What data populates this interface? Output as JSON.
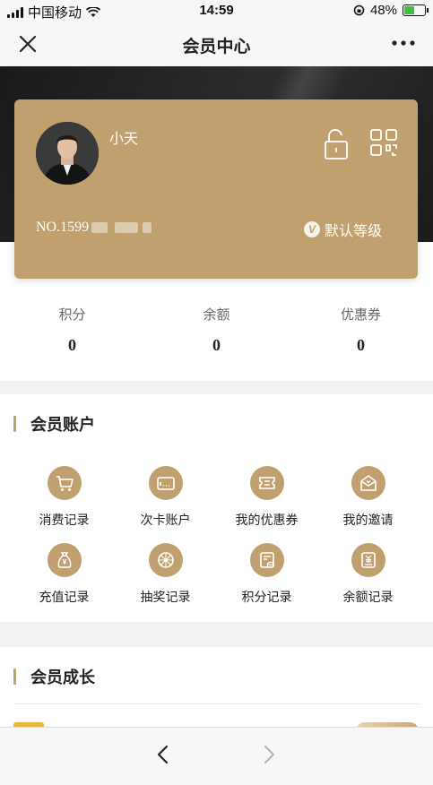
{
  "status_bar": {
    "carrier": "中国移动",
    "time": "14:59",
    "battery": "48%"
  },
  "nav": {
    "title": "会员中心"
  },
  "card": {
    "username": "小天",
    "member_no": "NO.1599",
    "level": "默认等级",
    "level_badge": "V"
  },
  "stats": [
    {
      "label": "积分",
      "value": "0"
    },
    {
      "label": "余额",
      "value": "0"
    },
    {
      "label": "优惠券",
      "value": "0"
    }
  ],
  "account_section": {
    "title": "会员账户",
    "items": [
      {
        "label": "消费记录",
        "icon": "cart-icon"
      },
      {
        "label": "次卡账户",
        "icon": "card-icon"
      },
      {
        "label": "我的优惠券",
        "icon": "coupon-icon"
      },
      {
        "label": "我的邀请",
        "icon": "invite-icon"
      },
      {
        "label": "充值记录",
        "icon": "money-bag-icon"
      },
      {
        "label": "抽奖记录",
        "icon": "wheel-icon"
      },
      {
        "label": "积分记录",
        "icon": "points-icon"
      },
      {
        "label": "余额记录",
        "icon": "balance-icon"
      }
    ]
  },
  "growth_section": {
    "title": "会员成长"
  },
  "colors": {
    "accent": "#bfa06e",
    "hero": "#1a1a1a",
    "page_bg": "#f2f2f2"
  }
}
